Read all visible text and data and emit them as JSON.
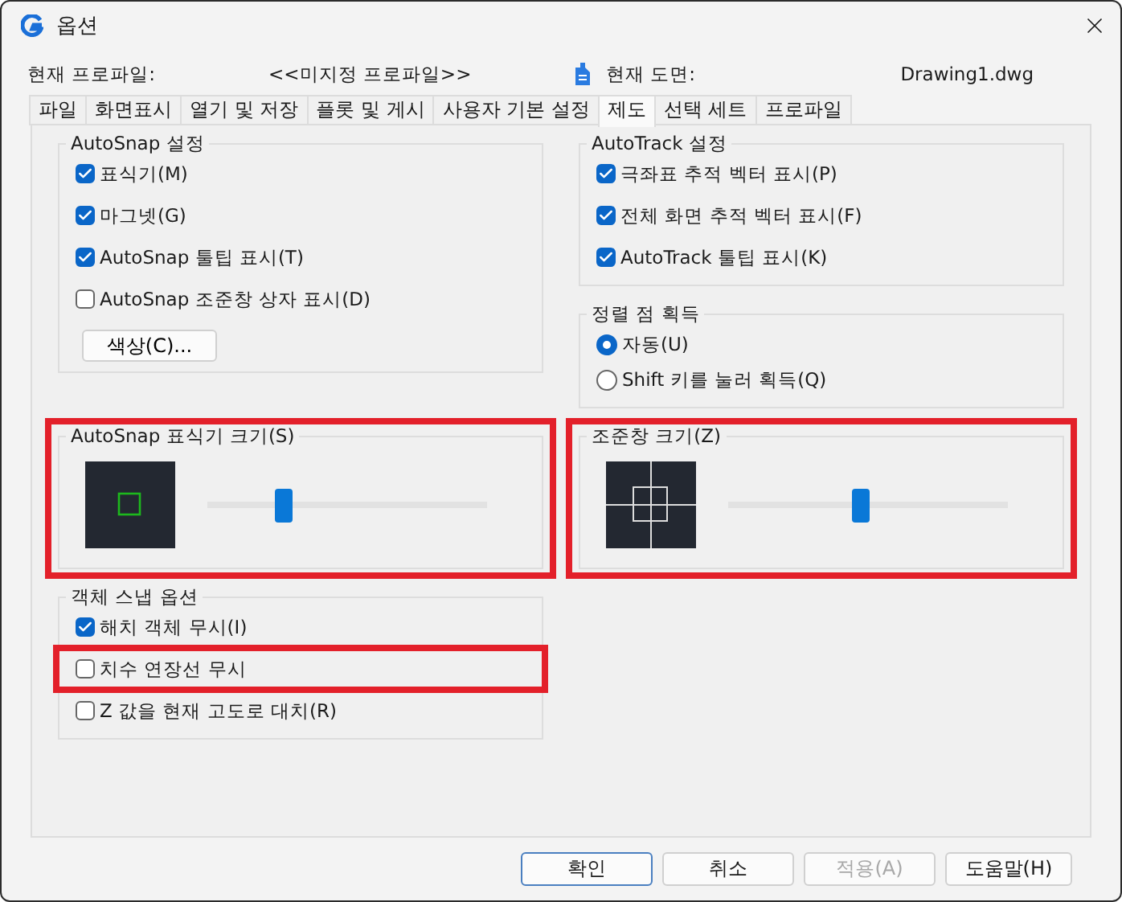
{
  "window": {
    "title": "옵션"
  },
  "profile": {
    "label": "현재 프로파일:",
    "value": "<<미지정 프로파일>>",
    "drawing_label": "현재 도면:",
    "drawing_value": "Drawing1.dwg"
  },
  "tabs": [
    {
      "label": "파일",
      "selected": false
    },
    {
      "label": "화면표시",
      "selected": false
    },
    {
      "label": "열기 및 저장",
      "selected": false
    },
    {
      "label": "플롯 및 게시",
      "selected": false
    },
    {
      "label": "사용자 기본 설정",
      "selected": false
    },
    {
      "label": "제도",
      "selected": true
    },
    {
      "label": "선택 세트",
      "selected": false
    },
    {
      "label": "프로파일",
      "selected": false
    }
  ],
  "rows": [
    {
      "cells": [
        {
          "groups": [
            {
              "title": "AutoSnap 설정",
              "kind": "options",
              "highlighted": false,
              "items": [
                {
                  "kind": "checkbox",
                  "label": "표식기(M)",
                  "checked": true,
                  "highlighted": false
                },
                {
                  "kind": "checkbox",
                  "label": "마그넷(G)",
                  "checked": true,
                  "highlighted": false
                },
                {
                  "kind": "checkbox",
                  "label": "AutoSnap 툴팁 표시(T)",
                  "checked": true,
                  "highlighted": false
                },
                {
                  "kind": "checkbox",
                  "label": "AutoSnap 조준창 상자 표시(D)",
                  "checked": false,
                  "highlighted": false
                },
                {
                  "kind": "button",
                  "label": "색상(C)..."
                }
              ]
            }
          ]
        },
        {
          "groups": [
            {
              "title": "AutoTrack 설정",
              "kind": "options",
              "highlighted": false,
              "items": [
                {
                  "kind": "checkbox",
                  "label": "극좌표 추적 벡터 표시(P)",
                  "checked": true,
                  "highlighted": false
                },
                {
                  "kind": "checkbox",
                  "label": "전체 화면 추적 벡터 표시(F)",
                  "checked": true,
                  "highlighted": false
                },
                {
                  "kind": "checkbox",
                  "label": "AutoTrack 툴팁 표시(K)",
                  "checked": true,
                  "highlighted": false
                }
              ]
            },
            {
              "title": "정렬 점 획득",
              "kind": "options",
              "highlighted": false,
              "items": [
                {
                  "kind": "radio",
                  "label": "자동(U)",
                  "selected": true
                },
                {
                  "kind": "radio",
                  "label": "Shift 키를 눌러 획득(Q)",
                  "selected": false
                }
              ]
            }
          ]
        }
      ]
    },
    {
      "cells": [
        {
          "groups": [
            {
              "title": "AutoSnap 표식기 크기(S)",
              "kind": "marker_slider",
              "level": 0.27,
              "highlighted": true
            }
          ]
        },
        {
          "groups": [
            {
              "title": "조준창 크기(Z)",
              "kind": "aperture_slider",
              "level": 0.47,
              "highlighted": true
            }
          ]
        }
      ]
    },
    {
      "cells": [
        {
          "groups": [
            {
              "title": "객체 스냅 옵션",
              "kind": "options",
              "highlighted": false,
              "items": [
                {
                  "kind": "checkbox",
                  "label": "해치 객체 무시(I)",
                  "checked": true,
                  "highlighted": false
                },
                {
                  "kind": "checkbox",
                  "label": "치수 연장선 무시",
                  "checked": false,
                  "highlighted": true
                },
                {
                  "kind": "checkbox",
                  "label": "Z 값을 현재 고도로 대치(R)",
                  "checked": false,
                  "highlighted": false
                }
              ]
            }
          ]
        }
      ]
    }
  ],
  "buttons": [
    {
      "label": "확인",
      "default": true,
      "disabled": false
    },
    {
      "label": "취소",
      "default": false,
      "disabled": false
    },
    {
      "label": "적용(A)",
      "default": false,
      "disabled": true
    },
    {
      "label": "도움말(H)",
      "default": false,
      "disabled": false
    }
  ]
}
